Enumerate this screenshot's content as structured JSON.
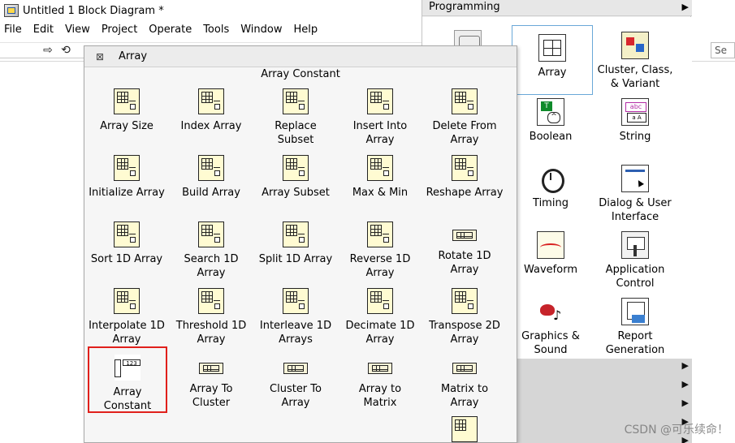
{
  "window": {
    "title": "Untitled 1 Block Diagram *"
  },
  "menu": [
    "File",
    "Edit",
    "View",
    "Project",
    "Operate",
    "Tools",
    "Window",
    "Help"
  ],
  "toolbar": {
    "search_text": "Se"
  },
  "programming_palette": {
    "title": "Programming",
    "items": [
      {
        "label": "",
        "icon": "partial-icon"
      },
      {
        "label": "Array",
        "icon": "array-icon"
      },
      {
        "label": "Cluster, Class,\n& Variant",
        "icon": "cluster-icon"
      },
      {
        "label": "Boolean",
        "icon": "boolean-icon"
      },
      {
        "label": "String",
        "icon": "string-icon"
      },
      {
        "label": "Timing",
        "icon": "timing-icon"
      },
      {
        "label": "Dialog & User\nInterface",
        "icon": "dialog-icon"
      },
      {
        "label": "Waveform",
        "icon": "waveform-icon"
      },
      {
        "label": "Application\nControl",
        "icon": "application-control-icon"
      },
      {
        "label": "Graphics &\nSound",
        "icon": "graphics-sound-icon"
      },
      {
        "label": "Report\nGeneration",
        "icon": "report-generation-icon"
      }
    ]
  },
  "array_palette": {
    "title": "Array",
    "subtitle": "Array Constant",
    "items": [
      {
        "label": "Array Size",
        "icon": "array-size-icon"
      },
      {
        "label": "Index Array",
        "icon": "index-array-icon"
      },
      {
        "label": "Replace\nSubset",
        "icon": "replace-subset-icon"
      },
      {
        "label": "Insert Into\nArray",
        "icon": "insert-into-array-icon"
      },
      {
        "label": "Delete From\nArray",
        "icon": "delete-from-array-icon"
      },
      {
        "label": "Initialize Array",
        "icon": "initialize-array-icon"
      },
      {
        "label": "Build Array",
        "icon": "build-array-icon"
      },
      {
        "label": "Array Subset",
        "icon": "array-subset-icon"
      },
      {
        "label": "Max & Min",
        "icon": "max-min-icon"
      },
      {
        "label": "Reshape Array",
        "icon": "reshape-array-icon"
      },
      {
        "label": "Sort 1D Array",
        "icon": "sort-1d-array-icon"
      },
      {
        "label": "Search 1D\nArray",
        "icon": "search-1d-array-icon"
      },
      {
        "label": "Split 1D Array",
        "icon": "split-1d-array-icon"
      },
      {
        "label": "Reverse 1D\nArray",
        "icon": "reverse-1d-array-icon"
      },
      {
        "label": "Rotate 1D\nArray",
        "icon": "rotate-1d-array-icon"
      },
      {
        "label": "Interpolate 1D\nArray",
        "icon": "interpolate-1d-array-icon"
      },
      {
        "label": "Threshold 1D\nArray",
        "icon": "threshold-1d-array-icon"
      },
      {
        "label": "Interleave 1D\nArrays",
        "icon": "interleave-1d-arrays-icon"
      },
      {
        "label": "Decimate 1D\nArray",
        "icon": "decimate-1d-array-icon"
      },
      {
        "label": "Transpose 2D\nArray",
        "icon": "transpose-2d-array-icon"
      },
      {
        "label": "Array Constant",
        "icon": "array-constant-icon"
      },
      {
        "label": "Array To\nCluster",
        "icon": "array-to-cluster-icon"
      },
      {
        "label": "Cluster To\nArray",
        "icon": "cluster-to-array-icon"
      },
      {
        "label": "Array to\nMatrix",
        "icon": "array-to-matrix-icon"
      },
      {
        "label": "Matrix to\nArray",
        "icon": "matrix-to-array-icon"
      },
      {
        "label": "",
        "icon": "matrix-icon"
      }
    ],
    "highlighted_item": "Array Constant",
    "highlight_color": "#e0201b"
  },
  "watermark": "CSDN @可乐续命！"
}
